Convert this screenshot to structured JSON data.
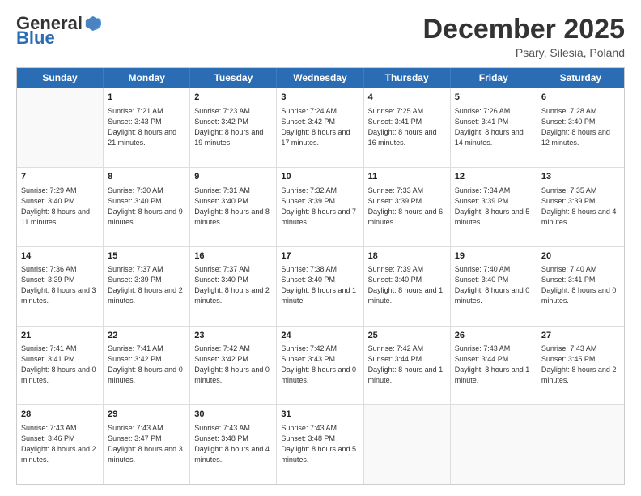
{
  "logo": {
    "general": "General",
    "blue": "Blue"
  },
  "title": {
    "month": "December 2025",
    "location": "Psary, Silesia, Poland"
  },
  "header": {
    "days": [
      "Sunday",
      "Monday",
      "Tuesday",
      "Wednesday",
      "Thursday",
      "Friday",
      "Saturday"
    ]
  },
  "weeks": [
    [
      {
        "day": "",
        "empty": true
      },
      {
        "day": "1",
        "sunrise": "Sunrise: 7:21 AM",
        "sunset": "Sunset: 3:43 PM",
        "daylight": "Daylight: 8 hours and 21 minutes."
      },
      {
        "day": "2",
        "sunrise": "Sunrise: 7:23 AM",
        "sunset": "Sunset: 3:42 PM",
        "daylight": "Daylight: 8 hours and 19 minutes."
      },
      {
        "day": "3",
        "sunrise": "Sunrise: 7:24 AM",
        "sunset": "Sunset: 3:42 PM",
        "daylight": "Daylight: 8 hours and 17 minutes."
      },
      {
        "day": "4",
        "sunrise": "Sunrise: 7:25 AM",
        "sunset": "Sunset: 3:41 PM",
        "daylight": "Daylight: 8 hours and 16 minutes."
      },
      {
        "day": "5",
        "sunrise": "Sunrise: 7:26 AM",
        "sunset": "Sunset: 3:41 PM",
        "daylight": "Daylight: 8 hours and 14 minutes."
      },
      {
        "day": "6",
        "sunrise": "Sunrise: 7:28 AM",
        "sunset": "Sunset: 3:40 PM",
        "daylight": "Daylight: 8 hours and 12 minutes."
      }
    ],
    [
      {
        "day": "7",
        "sunrise": "Sunrise: 7:29 AM",
        "sunset": "Sunset: 3:40 PM",
        "daylight": "Daylight: 8 hours and 11 minutes."
      },
      {
        "day": "8",
        "sunrise": "Sunrise: 7:30 AM",
        "sunset": "Sunset: 3:40 PM",
        "daylight": "Daylight: 8 hours and 9 minutes."
      },
      {
        "day": "9",
        "sunrise": "Sunrise: 7:31 AM",
        "sunset": "Sunset: 3:40 PM",
        "daylight": "Daylight: 8 hours and 8 minutes."
      },
      {
        "day": "10",
        "sunrise": "Sunrise: 7:32 AM",
        "sunset": "Sunset: 3:39 PM",
        "daylight": "Daylight: 8 hours and 7 minutes."
      },
      {
        "day": "11",
        "sunrise": "Sunrise: 7:33 AM",
        "sunset": "Sunset: 3:39 PM",
        "daylight": "Daylight: 8 hours and 6 minutes."
      },
      {
        "day": "12",
        "sunrise": "Sunrise: 7:34 AM",
        "sunset": "Sunset: 3:39 PM",
        "daylight": "Daylight: 8 hours and 5 minutes."
      },
      {
        "day": "13",
        "sunrise": "Sunrise: 7:35 AM",
        "sunset": "Sunset: 3:39 PM",
        "daylight": "Daylight: 8 hours and 4 minutes."
      }
    ],
    [
      {
        "day": "14",
        "sunrise": "Sunrise: 7:36 AM",
        "sunset": "Sunset: 3:39 PM",
        "daylight": "Daylight: 8 hours and 3 minutes."
      },
      {
        "day": "15",
        "sunrise": "Sunrise: 7:37 AM",
        "sunset": "Sunset: 3:39 PM",
        "daylight": "Daylight: 8 hours and 2 minutes."
      },
      {
        "day": "16",
        "sunrise": "Sunrise: 7:37 AM",
        "sunset": "Sunset: 3:40 PM",
        "daylight": "Daylight: 8 hours and 2 minutes."
      },
      {
        "day": "17",
        "sunrise": "Sunrise: 7:38 AM",
        "sunset": "Sunset: 3:40 PM",
        "daylight": "Daylight: 8 hours and 1 minute."
      },
      {
        "day": "18",
        "sunrise": "Sunrise: 7:39 AM",
        "sunset": "Sunset: 3:40 PM",
        "daylight": "Daylight: 8 hours and 1 minute."
      },
      {
        "day": "19",
        "sunrise": "Sunrise: 7:40 AM",
        "sunset": "Sunset: 3:40 PM",
        "daylight": "Daylight: 8 hours and 0 minutes."
      },
      {
        "day": "20",
        "sunrise": "Sunrise: 7:40 AM",
        "sunset": "Sunset: 3:41 PM",
        "daylight": "Daylight: 8 hours and 0 minutes."
      }
    ],
    [
      {
        "day": "21",
        "sunrise": "Sunrise: 7:41 AM",
        "sunset": "Sunset: 3:41 PM",
        "daylight": "Daylight: 8 hours and 0 minutes."
      },
      {
        "day": "22",
        "sunrise": "Sunrise: 7:41 AM",
        "sunset": "Sunset: 3:42 PM",
        "daylight": "Daylight: 8 hours and 0 minutes."
      },
      {
        "day": "23",
        "sunrise": "Sunrise: 7:42 AM",
        "sunset": "Sunset: 3:42 PM",
        "daylight": "Daylight: 8 hours and 0 minutes."
      },
      {
        "day": "24",
        "sunrise": "Sunrise: 7:42 AM",
        "sunset": "Sunset: 3:43 PM",
        "daylight": "Daylight: 8 hours and 0 minutes."
      },
      {
        "day": "25",
        "sunrise": "Sunrise: 7:42 AM",
        "sunset": "Sunset: 3:44 PM",
        "daylight": "Daylight: 8 hours and 1 minute."
      },
      {
        "day": "26",
        "sunrise": "Sunrise: 7:43 AM",
        "sunset": "Sunset: 3:44 PM",
        "daylight": "Daylight: 8 hours and 1 minute."
      },
      {
        "day": "27",
        "sunrise": "Sunrise: 7:43 AM",
        "sunset": "Sunset: 3:45 PM",
        "daylight": "Daylight: 8 hours and 2 minutes."
      }
    ],
    [
      {
        "day": "28",
        "sunrise": "Sunrise: 7:43 AM",
        "sunset": "Sunset: 3:46 PM",
        "daylight": "Daylight: 8 hours and 2 minutes."
      },
      {
        "day": "29",
        "sunrise": "Sunrise: 7:43 AM",
        "sunset": "Sunset: 3:47 PM",
        "daylight": "Daylight: 8 hours and 3 minutes."
      },
      {
        "day": "30",
        "sunrise": "Sunrise: 7:43 AM",
        "sunset": "Sunset: 3:48 PM",
        "daylight": "Daylight: 8 hours and 4 minutes."
      },
      {
        "day": "31",
        "sunrise": "Sunrise: 7:43 AM",
        "sunset": "Sunset: 3:48 PM",
        "daylight": "Daylight: 8 hours and 5 minutes."
      },
      {
        "day": "",
        "empty": true
      },
      {
        "day": "",
        "empty": true
      },
      {
        "day": "",
        "empty": true
      }
    ]
  ]
}
